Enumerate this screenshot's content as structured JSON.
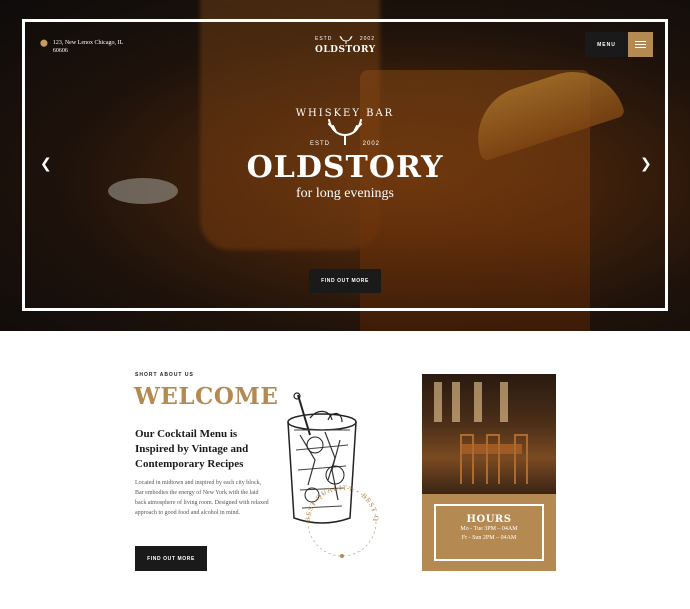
{
  "header": {
    "address": "123, New Lenox Chicago, IL 60606",
    "logo_estd": "ESTD",
    "logo_year": "2002",
    "logo_name": "OLDSTORY",
    "menu_label": "MENU"
  },
  "hero": {
    "subtitle": "WHISKEY BAR",
    "estd": "ESTD",
    "year": "2002",
    "title": "OLDSTORY",
    "tagline": "for long evenings",
    "button": "FIND OUT MORE"
  },
  "about": {
    "eyebrow": "SHORT ABOUT US",
    "title": "WELCOME",
    "heading": "Our Cocktail Menu is Inspired by Vintage and Contemporary Recipes",
    "body": "Located in midtown and inspired by each city block, Bar embodies the energy of New York with the laid back atmosphere of living room. Designed with relaxed approach to good food and alcohol in mind.",
    "button": "FIND OUT MORE",
    "badge_text": "BEST QUALITY · BEST QUALITY"
  },
  "hours": {
    "title": "HOURS",
    "line1": "Mo - Tue 3PM – 04AM",
    "line2": "Fr - Sun 2PM – 04AM"
  },
  "colors": {
    "accent": "#b58a52",
    "dark": "#1a1a1a"
  },
  "icons": [
    "location-pin-icon",
    "hamburger-icon",
    "chevron-left-icon",
    "chevron-right-icon",
    "antlers-icon"
  ]
}
